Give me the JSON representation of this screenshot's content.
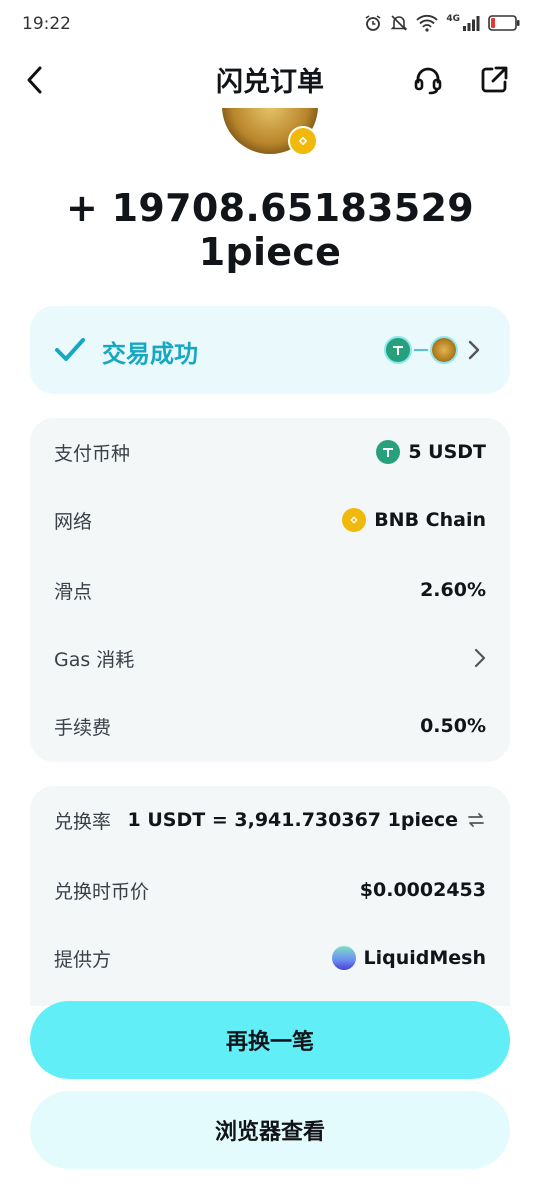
{
  "status_bar": {
    "time": "19:22",
    "network": "4G",
    "icons": [
      "alarm-icon",
      "mute-icon",
      "wifi-icon",
      "signal-icon",
      "battery-icon"
    ]
  },
  "header": {
    "title": "闪兑订单",
    "icons": [
      "back-icon",
      "headset-icon",
      "share-icon"
    ]
  },
  "token": {
    "amount": "+ 19708.65183529 1piece",
    "chain_badge_color": "#f0b90b"
  },
  "status_card": {
    "text": "交易成功",
    "accent_color": "#16a8c2",
    "icons": [
      "check-icon",
      "usdt-icon",
      "piece-icon",
      "chevron-right-icon"
    ]
  },
  "details": {
    "pay_token_label": "支付币种",
    "pay_token_value": "5 USDT",
    "network_label": "网络",
    "network_value": "BNB Chain",
    "slippage_label": "滑点",
    "slippage_value": "2.60%",
    "gas_label": "Gas 消耗",
    "fee_label": "手续费",
    "fee_value": "0.50%"
  },
  "exchange": {
    "rate_label": "兑换率",
    "rate_value": "1 USDT = 3,941.730367 1piece",
    "price_label": "兑换时币价",
    "price_value": "$0.0002453",
    "provider_label": "提供方",
    "provider_value": "LiquidMesh"
  },
  "actions": {
    "swap_again": "再换一笔",
    "view_browser": "浏览器查看",
    "primary_color": "#62eef6"
  }
}
